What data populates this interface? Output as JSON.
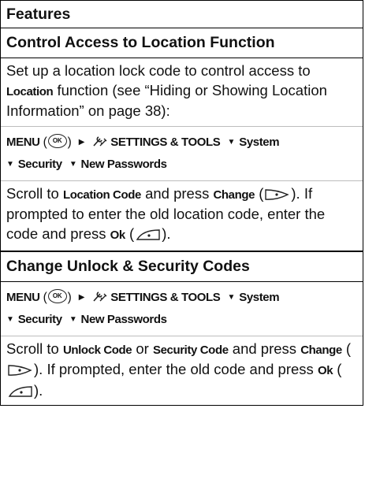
{
  "header": {
    "title": "Features"
  },
  "section1": {
    "title": "Control Access to Location Function",
    "intro_a": "Set up a location lock code to control access to ",
    "intro_b": "Location",
    "intro_c": " function (see “Hiding or Showing Location Information” on page 38):",
    "menu_label": "MENU",
    "settings_label": "SETTINGS & TOOLS",
    "path_system": "System",
    "path_security": "Security",
    "path_new_passwords": "New Passwords",
    "scroll_a": "Scroll to ",
    "scroll_b": "Location Code",
    "scroll_c": " and press ",
    "scroll_d": "Change",
    "scroll_e": " (",
    "scroll_f": "). If prompted to enter the old location code, enter the code and press ",
    "scroll_g": "Ok",
    "scroll_h": " (",
    "scroll_i": ")."
  },
  "section2": {
    "title": "Change Unlock & Security Codes",
    "menu_label": "MENU",
    "settings_label": "SETTINGS & TOOLS",
    "path_system": "System",
    "path_security": "Security",
    "path_new_passwords": "New Passwords",
    "scroll_a": "Scroll to ",
    "scroll_b": "Unlock Code",
    "scroll_c": " or ",
    "scroll_d": "Security Code",
    "scroll_e": " and press ",
    "scroll_f": "Change",
    "scroll_g": " (",
    "scroll_h": "). If prompted, enter the old code and press ",
    "scroll_i": "Ok",
    "scroll_j": " (",
    "scroll_k": ")."
  },
  "icons": {
    "ok_key_text": "OK",
    "tools_icon": "settings-tools-icon",
    "arrow_right": "▶",
    "arrow_down": "▼"
  }
}
